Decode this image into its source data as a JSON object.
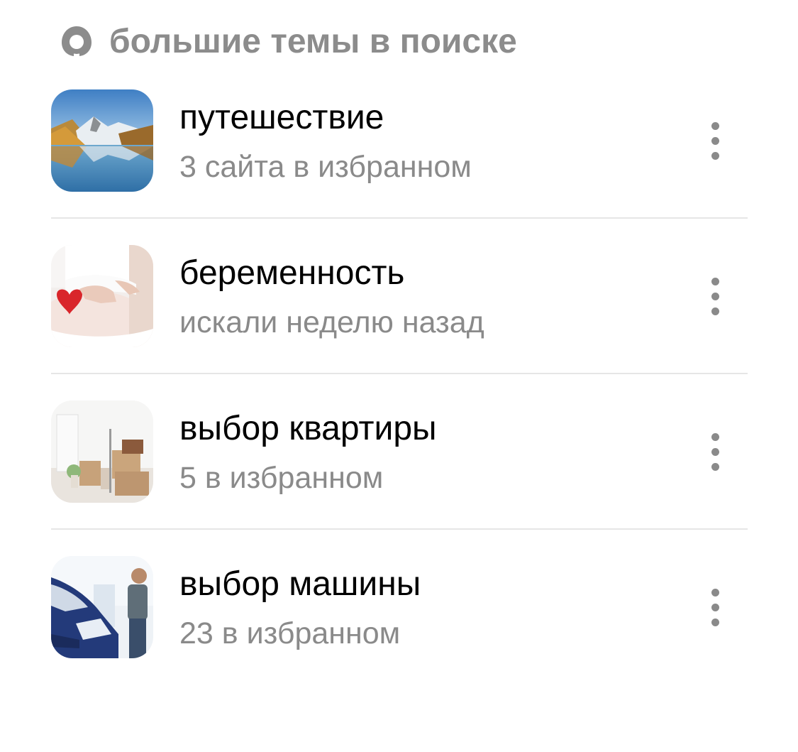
{
  "header": {
    "icon": "alice-icon",
    "title": "большие темы в поиске"
  },
  "topics": [
    {
      "name": "путешествие",
      "subtitle": "3 сайта в избранном",
      "thumbnail": "mountain-lake-image",
      "more_icon": "more-vertical-icon"
    },
    {
      "name": "беременность",
      "subtitle": "искали неделю назад",
      "thumbnail": "pregnancy-heart-image",
      "more_icon": "more-vertical-icon"
    },
    {
      "name": "выбор квартиры",
      "subtitle": "5 в избранном",
      "thumbnail": "apartment-boxes-image",
      "more_icon": "more-vertical-icon"
    },
    {
      "name": "выбор машины",
      "subtitle": "23 в избранном",
      "thumbnail": "car-showroom-image",
      "more_icon": "more-vertical-icon"
    }
  ],
  "colors": {
    "header_text": "#8c8c8c",
    "title_text": "#000000",
    "subtitle_text": "#8a8a8a",
    "divider": "#e6e6e6"
  }
}
